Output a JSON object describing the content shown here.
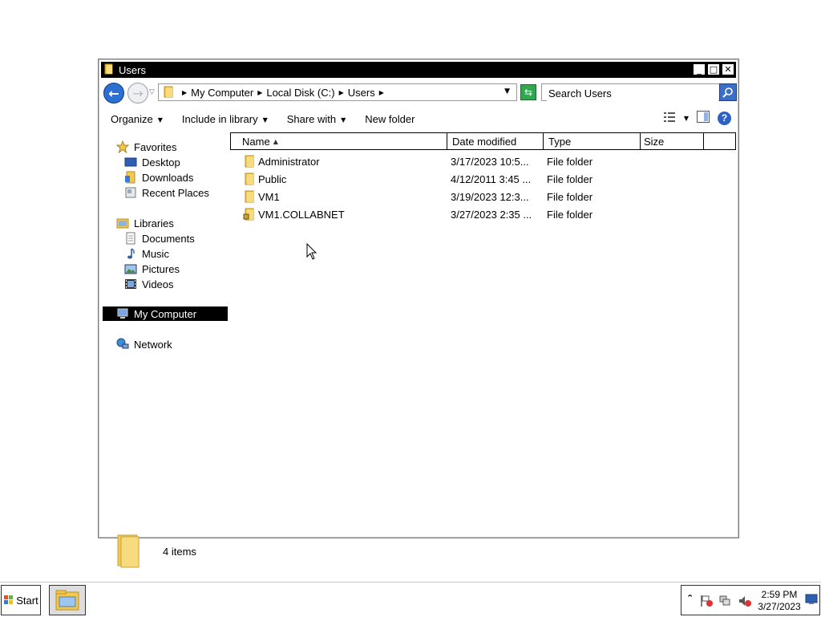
{
  "window": {
    "title": "Users",
    "controls": {
      "minimize": "_",
      "maximize": "□",
      "close": "✕"
    }
  },
  "address": {
    "breadcrumbs": [
      "My Computer",
      "Local Disk (C:)",
      "Users"
    ],
    "search_placeholder": "Search Users"
  },
  "commands": {
    "organize": "Organize",
    "include_in_library": "Include in library",
    "share_with": "Share with",
    "new_folder": "New folder"
  },
  "nav": {
    "favorites": "Favorites",
    "desktop": "Desktop",
    "downloads": "Downloads",
    "recent_places": "Recent Places",
    "libraries": "Libraries",
    "documents": "Documents",
    "music": "Music",
    "pictures": "Pictures",
    "videos": "Videos",
    "my_computer": "My Computer",
    "network": "Network"
  },
  "columns": {
    "name": "Name",
    "date": "Date modified",
    "type": "Type",
    "size": "Size"
  },
  "files": [
    {
      "name": "Administrator",
      "date": "3/17/2023 10:5...",
      "type": "File folder",
      "locked": false
    },
    {
      "name": "Public",
      "date": "4/12/2011 3:45 ...",
      "type": "File folder",
      "locked": false
    },
    {
      "name": "VM1",
      "date": "3/19/2023 12:3...",
      "type": "File folder",
      "locked": false
    },
    {
      "name": "VM1.COLLABNET",
      "date": "3/27/2023 2:35 ...",
      "type": "File folder",
      "locked": true
    }
  ],
  "details": {
    "count": "4 items"
  },
  "taskbar": {
    "start": "Start",
    "time": "2:59 PM",
    "date": "3/27/2023"
  },
  "colors": {
    "folder": "#f2c94c",
    "selection": "#000000",
    "accent": "#2a6fd1"
  }
}
